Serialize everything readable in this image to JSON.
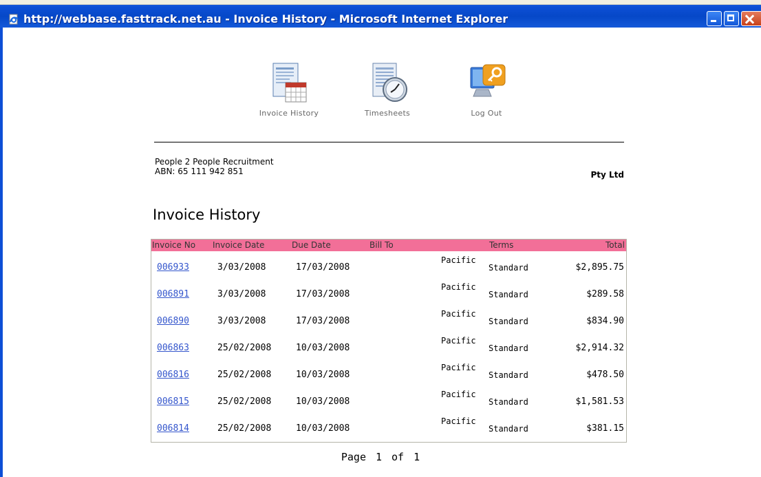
{
  "window": {
    "title": "http://webbase.fasttrack.net.au - Invoice History - Microsoft Internet Explorer"
  },
  "nav": {
    "items": [
      {
        "label": "Invoice History",
        "icon": "invoice-calendar-icon"
      },
      {
        "label": "Timesheets",
        "icon": "timesheet-clock-icon"
      },
      {
        "label": "Log Out",
        "icon": "logout-computer-key-icon"
      }
    ]
  },
  "company": {
    "name": "People 2 People Recruitment",
    "abn": "ABN: 65 111 942 851",
    "suffix": "Pty Ltd"
  },
  "page_title": "Invoice History",
  "table": {
    "header_color": "#f26f98",
    "link_color": "#3355cc",
    "columns": [
      "Invoice No",
      "Invoice Date",
      "Due Date",
      "Bill To",
      "Terms",
      "Total"
    ],
    "rows": [
      {
        "invoice_no": "006933",
        "invoice_date": "3/03/2008",
        "due_date": "17/03/2008",
        "bill_to": "Pacific",
        "terms": "Standard",
        "total": "$2,895.75"
      },
      {
        "invoice_no": "006891",
        "invoice_date": "3/03/2008",
        "due_date": "17/03/2008",
        "bill_to": "Pacific",
        "terms": "Standard",
        "total": "$289.58"
      },
      {
        "invoice_no": "006890",
        "invoice_date": "3/03/2008",
        "due_date": "17/03/2008",
        "bill_to": "Pacific",
        "terms": "Standard",
        "total": "$834.90"
      },
      {
        "invoice_no": "006863",
        "invoice_date": "25/02/2008",
        "due_date": "10/03/2008",
        "bill_to": "Pacific",
        "terms": "Standard",
        "total": "$2,914.32"
      },
      {
        "invoice_no": "006816",
        "invoice_date": "25/02/2008",
        "due_date": "10/03/2008",
        "bill_to": "Pacific",
        "terms": "Standard",
        "total": "$478.50"
      },
      {
        "invoice_no": "006815",
        "invoice_date": "25/02/2008",
        "due_date": "10/03/2008",
        "bill_to": "Pacific",
        "terms": "Standard",
        "total": "$1,581.53"
      },
      {
        "invoice_no": "006814",
        "invoice_date": "25/02/2008",
        "due_date": "10/03/2008",
        "bill_to": "Pacific",
        "terms": "Standard",
        "total": "$381.15"
      }
    ]
  },
  "pager": {
    "label": "Page",
    "current": "1",
    "of": "of",
    "total": "1"
  }
}
